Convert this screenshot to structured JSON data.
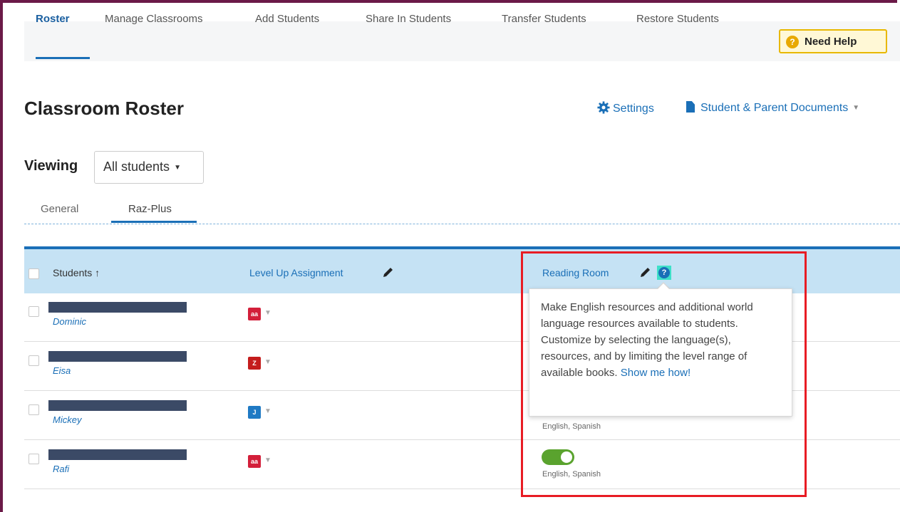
{
  "nav": {
    "items": [
      "Roster",
      "Manage Classrooms",
      "Add Students",
      "Share In Students",
      "Transfer Students",
      "Restore Students"
    ],
    "active": "Roster",
    "help_icon": "?",
    "help_label": "Need Help"
  },
  "header": {
    "title": "Classroom Roster",
    "settings_label": "Settings",
    "settings_icon": "gear-icon",
    "docs_label": "Student & Parent Documents",
    "docs_icon": "document-icon"
  },
  "viewing": {
    "label": "Viewing",
    "selected": "All students"
  },
  "tabs": [
    "General",
    "Raz-Plus"
  ],
  "active_tab": "Raz-Plus",
  "table": {
    "columns": {
      "students": "Students",
      "sort_indicator": "↑",
      "level_up": "Level Up Assignment",
      "reading_room": "Reading Room"
    },
    "rows": [
      {
        "name": "Dominic",
        "level": "aa",
        "level_color": "#d31f3a",
        "language": ""
      },
      {
        "name": "Eisa",
        "level": "Z",
        "level_color": "#c41d1d",
        "language": ""
      },
      {
        "name": "Mickey",
        "level": "J",
        "level_color": "#1f7ac4",
        "language": "English, Spanish"
      },
      {
        "name": "Rafi",
        "level": "aa",
        "level_color": "#d31f3a",
        "language": "English, Spanish",
        "toggle_on": true
      }
    ]
  },
  "tooltip": {
    "text": "Make English resources and additional world language resources available to students. Customize by selecting the language(s), resources, and by limiting the level range of available books. ",
    "link": "Show me how!",
    "help_icon": "?"
  },
  "colors": {
    "frame": "#6b1a48",
    "accent": "#1a6fb7",
    "highlight": "#e81c24",
    "toggle_on": "#5aa32e"
  }
}
